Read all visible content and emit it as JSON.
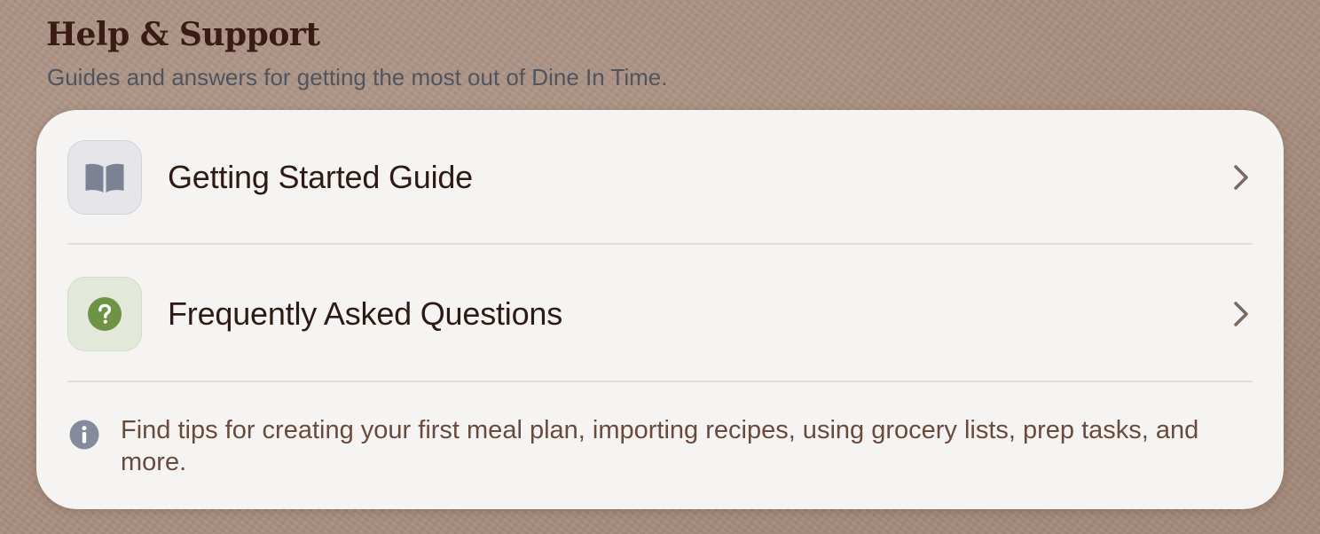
{
  "header": {
    "title": "Help & Support",
    "subtitle": "Guides and answers for getting the most out of Dine In Time."
  },
  "items": [
    {
      "label": "Getting Started Guide",
      "icon": "book-icon"
    },
    {
      "label": "Frequently Asked Questions",
      "icon": "question-circle-icon"
    }
  ],
  "info": {
    "icon": "info-circle-icon",
    "text": "Find tips for creating your first meal plan, importing recipes, using grocery lists, prep tasks, and more."
  },
  "colors": {
    "background": "#a88e7f",
    "card": "#f6f4f2",
    "title": "#3a1c14",
    "book_icon": "#7d8194",
    "faq_icon": "#6f9345",
    "chevron": "#7a6a63"
  }
}
